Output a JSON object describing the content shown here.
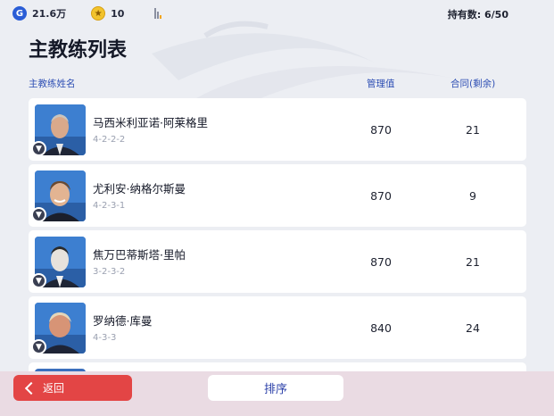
{
  "header": {
    "gp_value": "21.6万",
    "coin_value": "10",
    "owned_label": "持有数: 6/50"
  },
  "page_title": "主教练列表",
  "columns": {
    "name": "主教练姓名",
    "rating": "管理值",
    "contract": "合同(剩余)"
  },
  "coaches": [
    {
      "name": "马西米利亚诺·阿莱格里",
      "formation": "4-2-2-2",
      "rating": "870",
      "contract": "21"
    },
    {
      "name": "尤利安·纳格尔斯曼",
      "formation": "4-2-3-1",
      "rating": "870",
      "contract": "9"
    },
    {
      "name": "焦万巴蒂斯塔·里帕",
      "formation": "3-2-3-2",
      "rating": "870",
      "contract": "21"
    },
    {
      "name": "罗纳德·库曼",
      "formation": "4-3-3",
      "rating": "840",
      "contract": "24"
    }
  ],
  "footer": {
    "back_label": "返回",
    "sort_label": "排序"
  },
  "colors": {
    "accent_blue": "#2e4fb4",
    "back_red": "#e34545"
  }
}
